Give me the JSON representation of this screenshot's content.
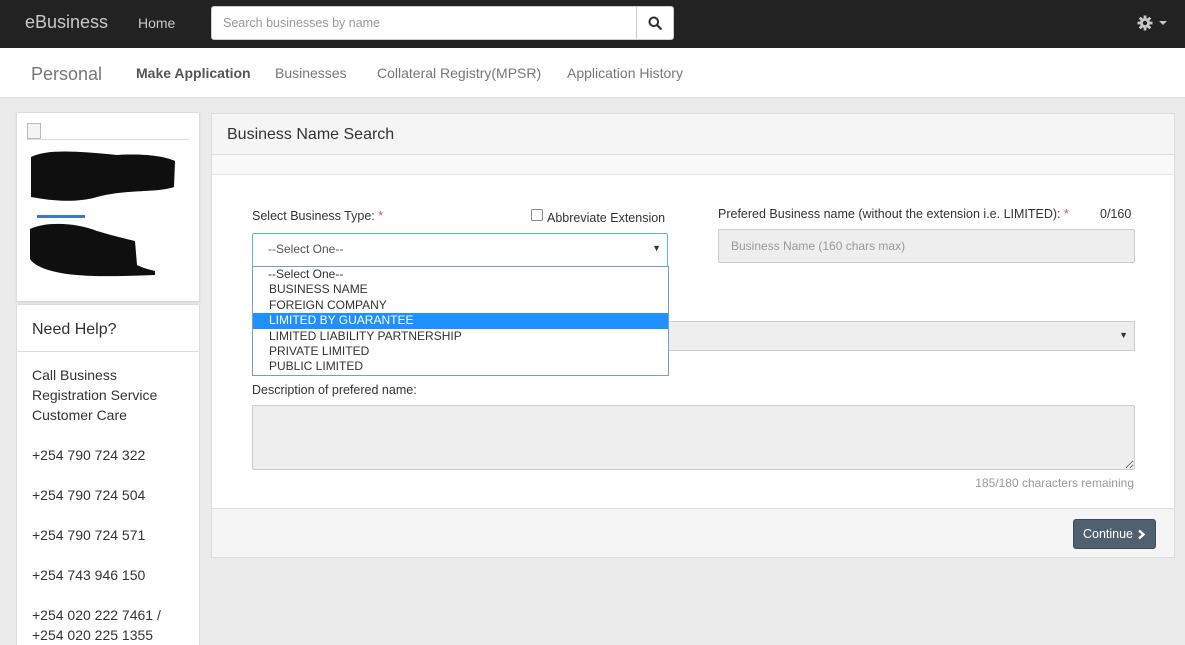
{
  "navbar": {
    "brand": "eBusiness",
    "home": "Home",
    "search_placeholder": "Search businesses by name"
  },
  "subnav": {
    "title": "Personal",
    "items": [
      "Make Application",
      "Businesses",
      "Collateral Registry(MPSR)",
      "Application History"
    ]
  },
  "help": {
    "title": "Need Help?",
    "lines": [
      "Call Business",
      "Registration Service",
      "Customer Care"
    ],
    "phones": [
      "+254 790 724 322",
      "+254 790 724 504",
      "+254 790 724 571",
      "+254 743 946 150",
      "+254 020 222 7461 /",
      "+254 020 225 1355"
    ]
  },
  "form": {
    "header": "Business Name Search",
    "business_type_label": "Select Business Type:",
    "required_mark": "*",
    "abbreviate_label": "Abbreviate Extension",
    "select_value": "--Select One--",
    "preferred_label": "Prefered Business name (without the extension i.e. LIMITED):",
    "char_count": "0/160",
    "name_placeholder": "Business Name (160 chars max)",
    "description_label": "Description of prefered name:",
    "remaining": "185/180 characters remaining",
    "continue_label": "Continue"
  },
  "dropdown": {
    "options": [
      "--Select One--",
      "BUSINESS NAME",
      "FOREIGN COMPANY",
      "LIMITED BY GUARANTEE",
      "LIMITED LIABILITY PARTNERSHIP",
      "PRIVATE LIMITED",
      "PUBLIC LIMITED"
    ],
    "selected_index": 3
  },
  "colors": {
    "navbar": "#222222",
    "highlight": "#1e90ff",
    "continue_button": "#4f6070",
    "required": "#d9534f"
  }
}
